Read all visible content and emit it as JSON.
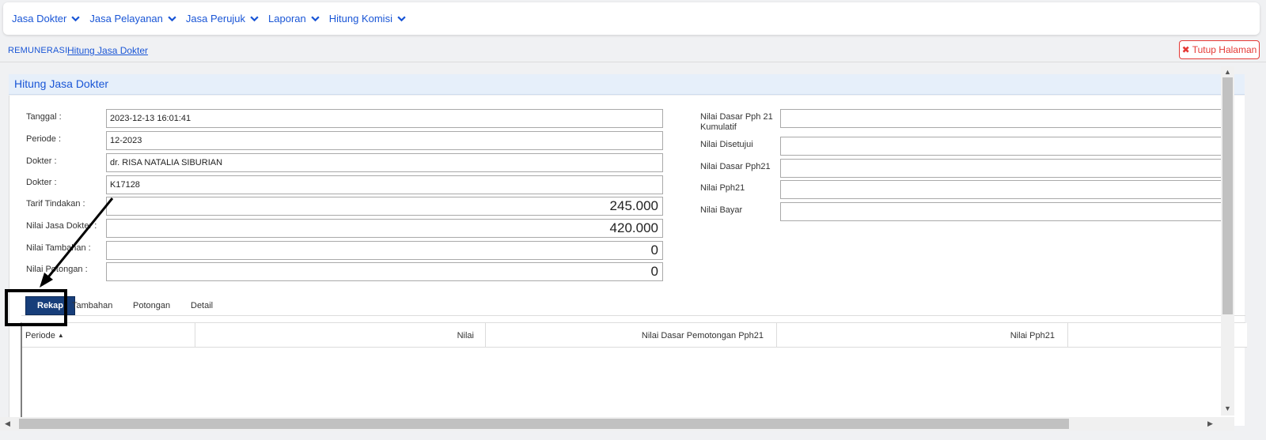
{
  "nav": {
    "items": [
      {
        "label": "Jasa Dokter"
      },
      {
        "label": "Jasa Pelayanan"
      },
      {
        "label": "Jasa Perujuk"
      },
      {
        "label": "Laporan"
      },
      {
        "label": "Hitung Komisi"
      }
    ]
  },
  "breadcrumb": {
    "root": "REMUNERASI",
    "current": "Hitung Jasa Dokter"
  },
  "close_button": {
    "label": "Tutup Halaman"
  },
  "panel": {
    "title": "Hitung Jasa Dokter"
  },
  "form_left": {
    "tanggal": {
      "label": "Tanggal :",
      "value": "2023-12-13 16:01:41"
    },
    "periode": {
      "label": "Periode :",
      "value": "12-2023"
    },
    "dokter_name": {
      "label": "Dokter :",
      "value": "dr. RISA NATALIA SIBURIAN"
    },
    "dokter_code": {
      "label": "Dokter :",
      "value": "K17128"
    },
    "tarif_tindakan": {
      "label": "Tarif Tindakan :",
      "value": "245.000"
    },
    "nilai_jasa_dokter": {
      "label": "Nilai Jasa Dokter :",
      "value": "420.000"
    },
    "nilai_tambahan": {
      "label": "Nilai Tambahan :",
      "value": "0"
    },
    "nilai_potongan": {
      "label": "Nilai Potongan :",
      "value": "0"
    }
  },
  "form_right": {
    "nilai_dasar_pph21_kumulatif": {
      "label_line1": "Nilai Dasar Pph 21",
      "label_line2": "Kumulatif",
      "value": ""
    },
    "nilai_disetujui": {
      "label": "Nilai Disetujui",
      "value": ""
    },
    "nilai_dasar_pph21": {
      "label": "Nilai Dasar Pph21",
      "value": ""
    },
    "nilai_pph21": {
      "label": "Nilai Pph21",
      "value": ""
    },
    "nilai_bayar": {
      "label": "Nilai Bayar",
      "value": ""
    }
  },
  "tabs": [
    {
      "label": "Rekap",
      "active": true
    },
    {
      "label": "Tambahan"
    },
    {
      "label": "Potongan"
    },
    {
      "label": "Detail"
    }
  ],
  "grid": {
    "columns": [
      {
        "label": "Periode",
        "sort": "asc"
      },
      {
        "label": "Nilai"
      },
      {
        "label": "Nilai Dasar Pemotongan Pph21"
      },
      {
        "label": "Nilai Pph21"
      }
    ],
    "rows": []
  },
  "colors": {
    "accent": "#1a56d6",
    "active_tab": "#173e7a",
    "danger": "#e53935",
    "panel_header": "#e6effa"
  }
}
